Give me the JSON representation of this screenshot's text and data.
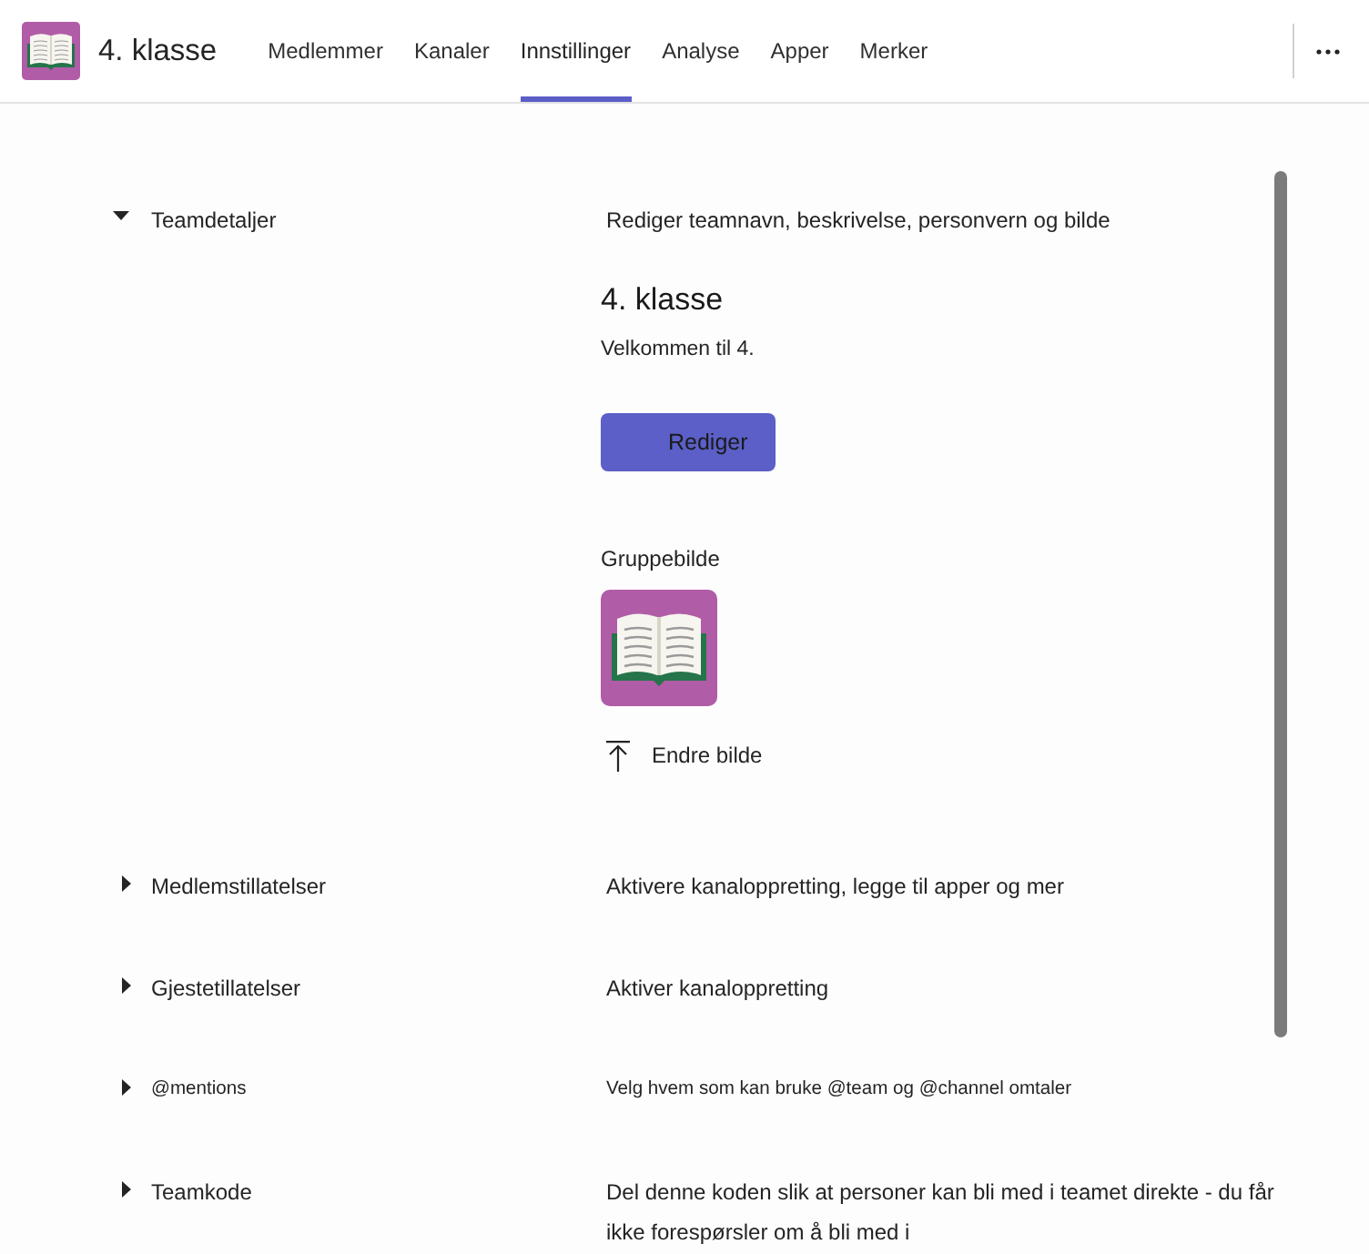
{
  "team": {
    "name": "4. klasse"
  },
  "tabs": [
    {
      "label": "Medlemmer",
      "selected": false
    },
    {
      "label": "Kanaler",
      "selected": false
    },
    {
      "label": "Innstillinger",
      "selected": true
    },
    {
      "label": "Analyse",
      "selected": false
    },
    {
      "label": "Apper",
      "selected": false
    },
    {
      "label": "Merker",
      "selected": false
    }
  ],
  "sections": [
    {
      "kind": "standard",
      "title": "Teamdetaljer",
      "expanded": true,
      "description": "Rediger teamnavn, beskrivelse, personvern og bilde",
      "details": {
        "team_name": "4. klasse",
        "team_description": "Velkommen til 4.",
        "edit_button": "Rediger",
        "picture_label": "Gruppebilde",
        "change_picture_button": "Endre bilde"
      }
    },
    {
      "kind": "standard",
      "title": "Medlemstillatelser",
      "expanded": false,
      "description": "Aktivere kanaloppretting, legge til apper og mer"
    },
    {
      "kind": "standard",
      "title": "Gjestetillatelser",
      "expanded": false,
      "description": "Aktiver kanaloppretting"
    },
    {
      "kind": "compact",
      "title": "@mentions",
      "expanded": false,
      "description": "Velg hvem som kan bruke @team og @channel omtaler"
    },
    {
      "kind": "standard",
      "title": "Teamkode",
      "expanded": false,
      "description": "Del denne koden slik at personer kan bli med i teamet direkte - du får ikke forespørsler om å bli med i"
    }
  ]
}
